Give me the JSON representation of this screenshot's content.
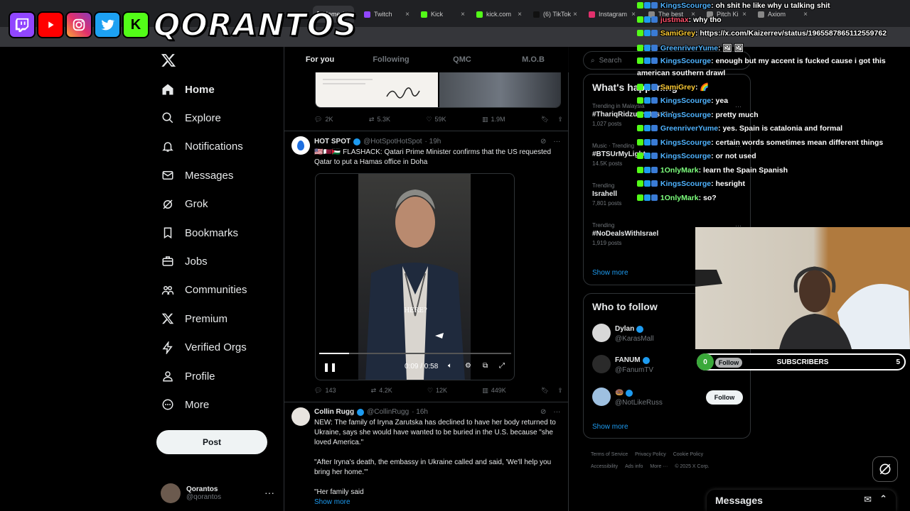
{
  "browser": {
    "tabs": [
      {
        "label": "Home / X",
        "color": "#ffffff",
        "active": true
      },
      {
        "label": "Twitch",
        "color": "#9146ff"
      },
      {
        "label": "Kick",
        "color": "#53fc18"
      },
      {
        "label": "kick.com",
        "color": "#53fc18"
      },
      {
        "label": "(6) TikTok",
        "color": "#111111"
      },
      {
        "label": "Instagram",
        "color": "#e1306c"
      },
      {
        "label": "The best",
        "color": "#888888"
      },
      {
        "label": "Pitch Ki",
        "color": "#888888"
      },
      {
        "label": "Axiom",
        "color": "#888888"
      }
    ]
  },
  "banner": {
    "brand": "QORANTOS",
    "platforms": [
      "twitch",
      "youtube",
      "instagram",
      "twitter",
      "kick"
    ]
  },
  "sidebar": {
    "items": [
      {
        "label": "Home",
        "icon": "home-icon"
      },
      {
        "label": "Explore",
        "icon": "search-icon"
      },
      {
        "label": "Notifications",
        "icon": "bell-icon"
      },
      {
        "label": "Messages",
        "icon": "envelope-icon"
      },
      {
        "label": "Grok",
        "icon": "grok-icon"
      },
      {
        "label": "Bookmarks",
        "icon": "bookmark-icon"
      },
      {
        "label": "Jobs",
        "icon": "briefcase-icon"
      },
      {
        "label": "Communities",
        "icon": "people-icon"
      },
      {
        "label": "Premium",
        "icon": "x-logo-icon"
      },
      {
        "label": "Verified Orgs",
        "icon": "lightning-icon"
      },
      {
        "label": "Profile",
        "icon": "person-icon"
      },
      {
        "label": "More",
        "icon": "more-circle-icon"
      }
    ],
    "post_label": "Post",
    "profile": {
      "name": "Qorantos",
      "handle": "@qorantos"
    }
  },
  "feed": {
    "tabs": [
      "For you",
      "Following",
      "QMC",
      "M.O.B"
    ],
    "prev_actions": {
      "replies": "2K",
      "reposts": "5.3K",
      "likes": "59K",
      "views": "1.9M"
    },
    "tweet1": {
      "name": "HOT SPOT",
      "handle": "@HotSpotHotSpot",
      "time": "· 19h",
      "text": "🇺🇸🇶🇦🇵🇸 FLASHACK: Qatari Prime Minister confirms that the US requested Qatar to put a Hamas office in Doha",
      "video": {
        "caption": "HERE?",
        "time": "0:09 / 0:58",
        "progress": 0.155
      },
      "actions": {
        "replies": "143",
        "reposts": "4.2K",
        "likes": "12K",
        "views": "449K"
      }
    },
    "tweet2": {
      "name": "Collin Rugg",
      "handle": "@CollinRugg",
      "time": "· 16h",
      "p1": "NEW: The family of Iryna Zarutska has declined to have her body returned to Ukraine, says she would have wanted to be buried in the U.S. because \"she loved America.\"",
      "p2": "\"After Iryna's death, the embassy in Ukraine called and said, 'We'll help you bring her home.'\"",
      "p3": "\"Her family said",
      "show_more": "Show more"
    }
  },
  "right": {
    "search_placeholder": "Search",
    "happening_title": "What's happening",
    "trends": [
      {
        "context": "Trending in Malaysia",
        "name": "#ThariqRidzuanMustReturn",
        "posts": "1,027 posts"
      },
      {
        "context": "Music · Trending",
        "name": "#BTSUrMyLight",
        "posts": "14.5K posts"
      },
      {
        "context": "Trending",
        "name": "Israhell",
        "posts": "7,801 posts"
      },
      {
        "context": "Trending",
        "name": "#NoDealsWithIsrael",
        "posts": "1,919 posts"
      }
    ],
    "show_more": "Show more",
    "wtf_title": "Who to follow",
    "wtf": [
      {
        "name": "Dylan",
        "handle": "@KarasMall",
        "color": "#d8d8d8"
      },
      {
        "name": "FANUM",
        "handle": "@FanumTV",
        "color": "#2a2a2a"
      },
      {
        "name": "🍩",
        "handle": "@NotLikeRuss",
        "color": "#9ec0e0"
      }
    ],
    "follow_label": "Follow",
    "footer": [
      "Terms of Service",
      "Privacy Policy",
      "Cookie Policy",
      "Accessibility",
      "Ads info",
      "More ···",
      "© 2025 X Corp."
    ],
    "messages_label": "Messages"
  },
  "chat": [
    {
      "user": "KingsScourge",
      "text": ": oh shit he like why u talking shit",
      "cls": "cu"
    },
    {
      "user": "justmax",
      "text": ": why tho",
      "cls": "cu4"
    },
    {
      "user": "SamiGrey",
      "text": ": https://x.com/Kaizerrev/status/1965587865112559762",
      "cls": "cu2"
    },
    {
      "user": "GreenriverYume",
      "text": ": 🖼 🖼",
      "cls": "cu"
    },
    {
      "user": "KingsScourge",
      "text": ": enough but my accent is fucked cause i got this",
      "cls": "cu"
    },
    {
      "user": "",
      "text": "american southern drawl",
      "cls": ""
    },
    {
      "user": "SamiGrey",
      "text": ": 🌈",
      "cls": "cu2"
    },
    {
      "user": "KingsScourge",
      "text": ": yea",
      "cls": "cu"
    },
    {
      "user": "KingsScourge",
      "text": ": pretty much",
      "cls": "cu"
    },
    {
      "user": "GreenriverYume",
      "text": ": yes. Spain is catalonia and formal",
      "cls": "cu"
    },
    {
      "user": "KingsScourge",
      "text": ": certain words sometimes mean different things",
      "cls": "cu"
    },
    {
      "user": "KingsScourge",
      "text": ": or not used",
      "cls": "cu"
    },
    {
      "user": "1OnlyMark",
      "text": ": learn the Spain Spanish",
      "cls": "cu3"
    },
    {
      "user": "KingsScourge",
      "text": ": hesright",
      "cls": "cu"
    },
    {
      "user": "1OnlyMark",
      "text": ": so?",
      "cls": "cu3"
    }
  ],
  "stream": {
    "subs_left": "0",
    "subs_label": "SUBSCRIBERS",
    "subs_goal": "5"
  }
}
